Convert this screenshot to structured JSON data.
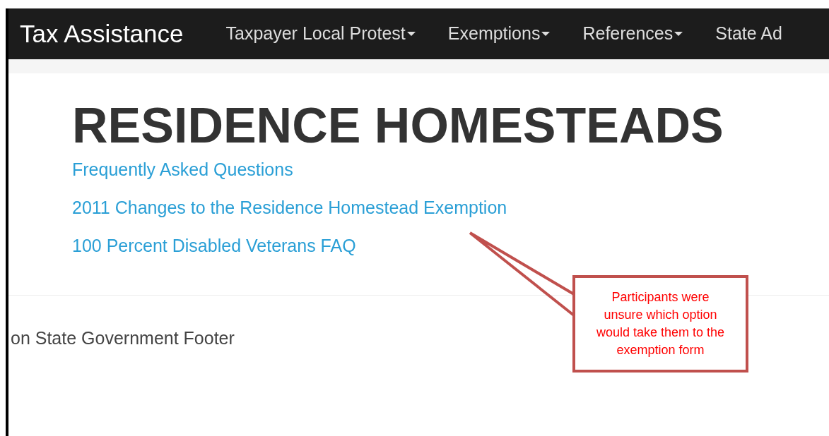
{
  "navbar": {
    "brand": "Tax Assistance",
    "items": [
      {
        "label": "Taxpayer Local Protest",
        "dropdown": true
      },
      {
        "label": "Exemptions",
        "dropdown": true
      },
      {
        "label": "References",
        "dropdown": true
      },
      {
        "label": "State Ad",
        "dropdown": false
      }
    ]
  },
  "heading": "RESIDENCE HOMESTEADS",
  "links": [
    "Frequently Asked Questions",
    "2011 Changes to the Residence Homestead Exemption",
    "100 Percent Disabled Veterans FAQ"
  ],
  "footer": "on State Government Footer",
  "callout": {
    "text": "Participants were unsure which option would take them to the exemption form"
  }
}
